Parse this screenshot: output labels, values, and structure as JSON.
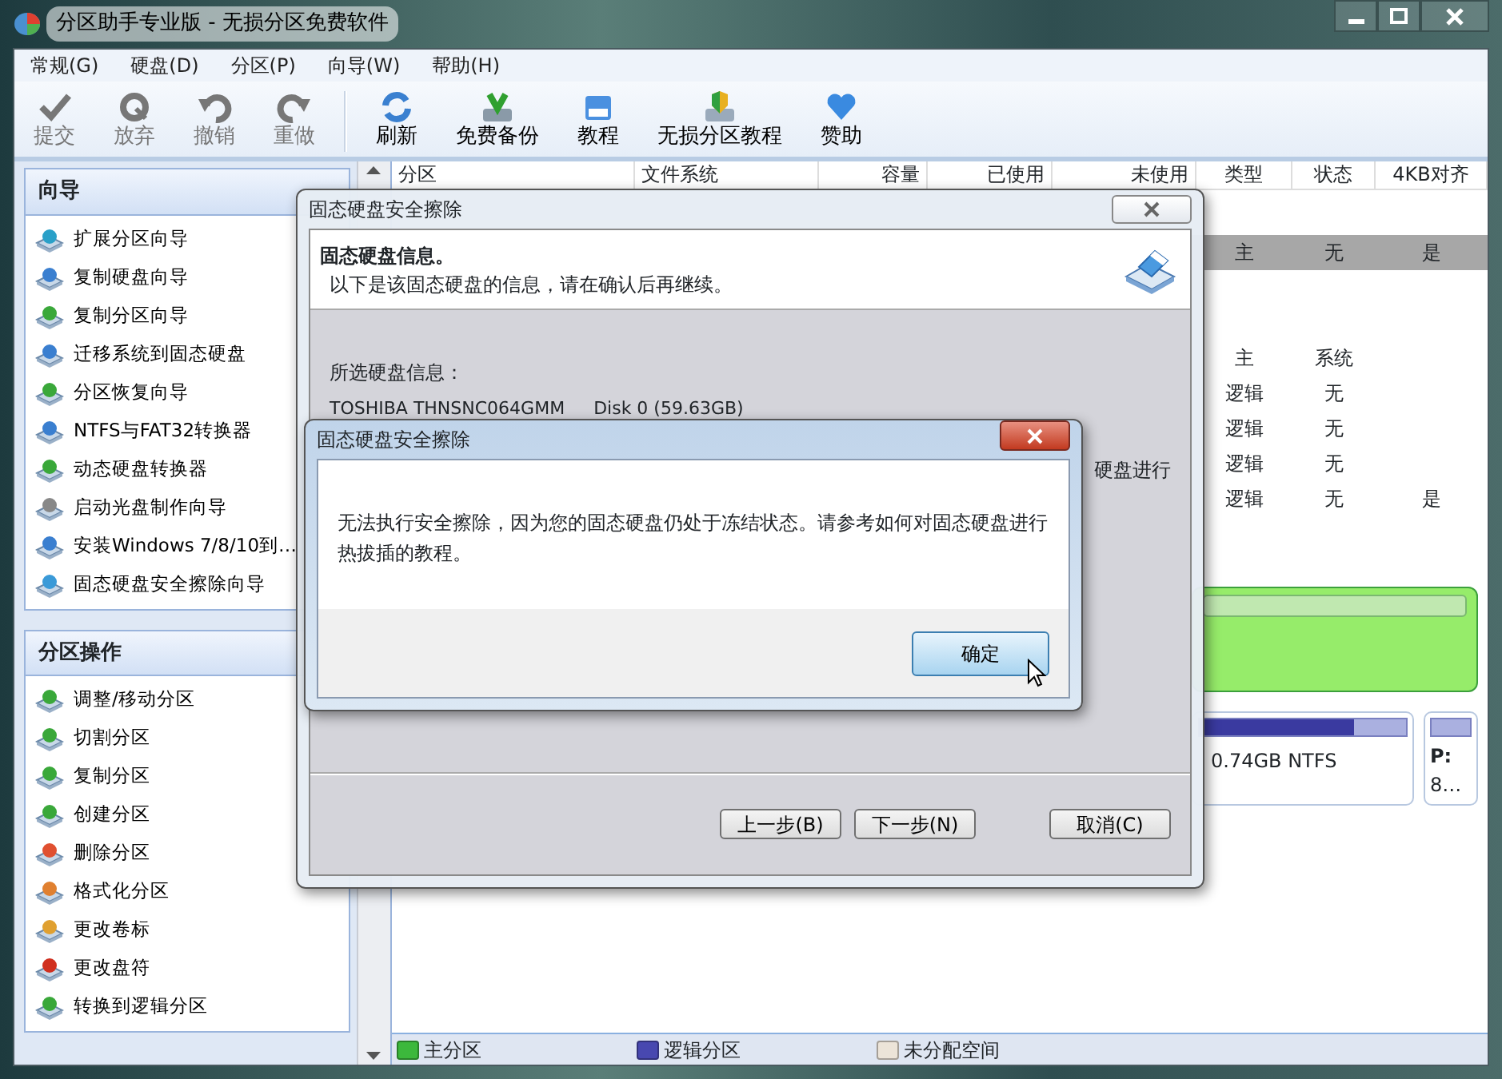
{
  "window": {
    "title": "分区助手专业版 - 无损分区免费软件"
  },
  "menu": [
    "常规(G)",
    "硬盘(D)",
    "分区(P)",
    "向导(W)",
    "帮助(H)"
  ],
  "toolbar": [
    {
      "label": "提交",
      "kind": "check",
      "disabled": true
    },
    {
      "label": "放弃",
      "kind": "discard",
      "disabled": true
    },
    {
      "label": "撤销",
      "kind": "undo",
      "disabled": true
    },
    {
      "label": "重做",
      "kind": "redo",
      "disabled": true
    },
    {
      "label": "刷新",
      "kind": "refresh",
      "disabled": false
    },
    {
      "label": "免费备份",
      "kind": "backup",
      "disabled": false
    },
    {
      "label": "教程",
      "kind": "book",
      "disabled": false
    },
    {
      "label": "无损分区教程",
      "kind": "shield",
      "disabled": false
    },
    {
      "label": "赞助",
      "kind": "heart",
      "disabled": false
    }
  ],
  "sidebar": [
    {
      "title": "向导",
      "items": [
        {
          "label": "扩展分区向导",
          "color": "#2aa0c8"
        },
        {
          "label": "复制硬盘向导",
          "color": "#3a7fd0"
        },
        {
          "label": "复制分区向导",
          "color": "#3aa83a"
        },
        {
          "label": "迁移系统到固态硬盘",
          "color": "#3a7fd0"
        },
        {
          "label": "分区恢复向导",
          "color": "#3aa83a"
        },
        {
          "label": "NTFS与FAT32转换器",
          "color": "#3a7fd0"
        },
        {
          "label": "动态硬盘转换器",
          "color": "#3aa83a"
        },
        {
          "label": "启动光盘制作向导",
          "color": "#888888"
        },
        {
          "label": "安装Windows 7/8/10到…",
          "color": "#3a7fd0"
        },
        {
          "label": "固态硬盘安全擦除向导",
          "color": "#3a9ad8"
        }
      ]
    },
    {
      "title": "分区操作",
      "items": [
        {
          "label": "调整/移动分区",
          "color": "#3aa83a"
        },
        {
          "label": "切割分区",
          "color": "#3aa83a"
        },
        {
          "label": "复制分区",
          "color": "#3aa83a"
        },
        {
          "label": "创建分区",
          "color": "#3aa83a"
        },
        {
          "label": "删除分区",
          "color": "#e05030"
        },
        {
          "label": "格式化分区",
          "color": "#e08030"
        },
        {
          "label": "更改卷标",
          "color": "#e0a030"
        },
        {
          "label": "更改盘符",
          "color": "#d03020"
        },
        {
          "label": "转换到逻辑分区",
          "color": "#3aa83a"
        }
      ]
    }
  ],
  "table": {
    "columns": [
      "分区",
      "文件系统",
      "容量",
      "已使用",
      "未使用",
      "类型",
      "状态",
      "4KB对齐"
    ],
    "disks": [
      {
        "rows": [
          {
            "type": "主",
            "status": "无",
            "aligned": "是",
            "selected": true
          }
        ]
      },
      {
        "rows": [
          {
            "type": "主",
            "status": "系统",
            "selected": false
          },
          {
            "type": "逻辑",
            "status": "无",
            "selected": false
          },
          {
            "type": "逻辑",
            "status": "无",
            "selected": false
          },
          {
            "type": "逻辑",
            "status": "无",
            "selected": false
          },
          {
            "type": "逻辑",
            "status": "无",
            "aligned": "是",
            "selected": false
          }
        ]
      }
    ]
  },
  "disk_map": {
    "lower": {
      "size": "0.74GB NTFS",
      "small_label": "P:",
      "small_size": "8…"
    }
  },
  "legend": [
    {
      "label": "主分区",
      "color": "#3cb83c"
    },
    {
      "label": "逻辑分区",
      "color": "#4848b0"
    },
    {
      "label": "未分配空间",
      "color": "#ece4d8"
    }
  ],
  "wizard": {
    "title": "固态硬盘安全擦除",
    "heading": "固态硬盘信息。",
    "subtitle": "以下是该固态硬盘的信息，请在确认后再继续。",
    "section": "所选硬盘信息：",
    "disk_model": "TOSHIBA THNSNC064GMM",
    "disk_name": "Disk 0 (59.63GB)",
    "fragment": "硬盘进行",
    "buttons": [
      "上一步(B)",
      "下一步(N)",
      "取消(C)"
    ]
  },
  "message": {
    "title": "固态硬盘安全擦除",
    "text": "无法执行安全擦除，因为您的固态硬盘仍处于冻结状态。请参考如何对固态硬盘进行热拔插的教程。",
    "button": "确定"
  }
}
